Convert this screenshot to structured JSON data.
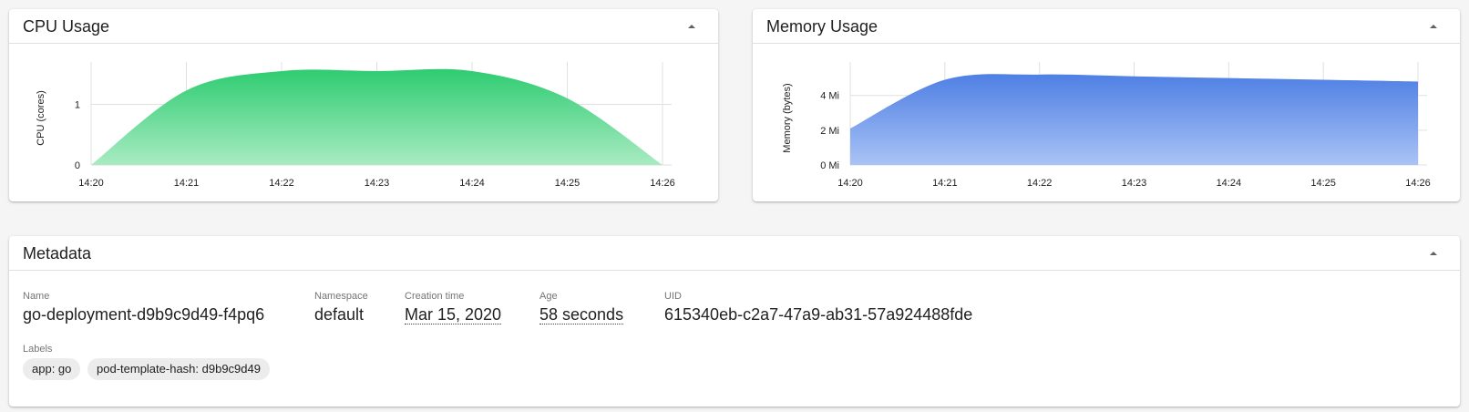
{
  "cpu_card": {
    "title": "CPU Usage",
    "chart_data": {
      "type": "area",
      "ylabel": "CPU (cores)",
      "x": [
        "14:20",
        "14:21",
        "14:22",
        "14:23",
        "14:24",
        "14:25",
        "14:26"
      ],
      "y_ticks": [
        "0",
        "1"
      ],
      "ylim": [
        0,
        1.55
      ],
      "series": [
        {
          "values": [
            0,
            1.23,
            1.55,
            1.55,
            1.55,
            1.1,
            0
          ]
        }
      ],
      "grid": true,
      "color": "#2ecc71"
    }
  },
  "memory_card": {
    "title": "Memory Usage",
    "chart_data": {
      "type": "area",
      "ylabel": "Memory (bytes)",
      "x": [
        "14:20",
        "14:21",
        "14:22",
        "14:23",
        "14:24",
        "14:25",
        "14:26"
      ],
      "y_ticks": [
        "0 Mi",
        "2 Mi",
        "4 Mi"
      ],
      "ylim": [
        0,
        5.4
      ],
      "series": [
        {
          "values": [
            2.1,
            4.9,
            5.2,
            5.1,
            5.0,
            4.9,
            4.8
          ]
        }
      ],
      "grid": true,
      "color": "#5b8ce8"
    }
  },
  "metadata": {
    "title": "Metadata",
    "name_label": "Name",
    "name_value": "go-deployment-d9b9c9d49-f4pq6",
    "namespace_label": "Namespace",
    "namespace_value": "default",
    "creation_label": "Creation time",
    "creation_value": "Mar 15, 2020",
    "age_label": "Age",
    "age_value": "58 seconds",
    "uid_label": "UID",
    "uid_value": "615340eb-c2a7-47a9-ab31-57a924488fde",
    "labels_label": "Labels",
    "labels": [
      "app: go",
      "pod-template-hash: d9b9c9d49"
    ]
  }
}
